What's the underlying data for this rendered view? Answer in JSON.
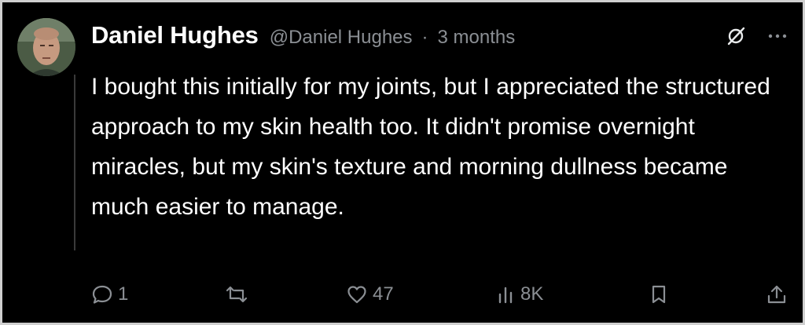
{
  "post": {
    "author_name": "Daniel Hughes",
    "author_handle": "@Daniel Hughes",
    "separator": "·",
    "timestamp": "3 months",
    "body": "I bought this initially for my joints, but I appreciated the structured approach to my skin health too. It didn't promise overnight miracles, but my skin's texture and morning dullness became much easier to manage."
  },
  "actions": {
    "reply_count": "1",
    "repost_count": "",
    "like_count": "47",
    "views_count": "8K"
  },
  "icons": {
    "top_right": [
      "grok-icon",
      "more-icon"
    ],
    "action_bar": [
      "reply-icon",
      "repost-icon",
      "like-icon",
      "views-icon",
      "bookmark-icon",
      "share-icon"
    ]
  },
  "colors": {
    "background": "#000000",
    "text": "#ffffff",
    "muted": "#8b8f94",
    "frame": "#cfcfcf"
  }
}
